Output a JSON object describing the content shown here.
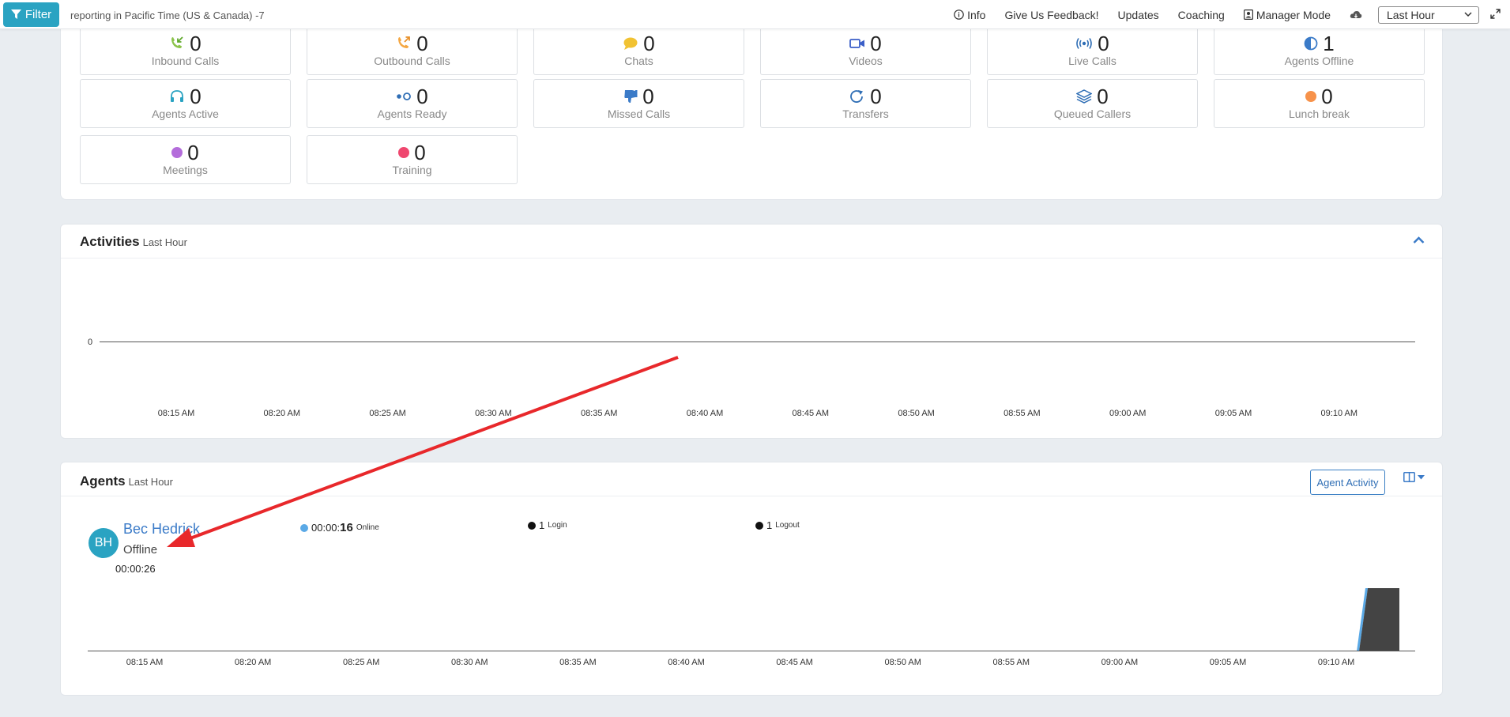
{
  "topbar": {
    "filter_label": "Filter",
    "timezone_text": "reporting in Pacific Time (US & Canada) -7",
    "links": {
      "info": "Info",
      "feedback": "Give Us Feedback!",
      "updates": "Updates",
      "coaching": "Coaching",
      "manager_mode": "Manager Mode"
    },
    "period_select": "Last Hour"
  },
  "stats": {
    "inbound_calls": {
      "value": "0",
      "label": "Inbound Calls"
    },
    "outbound_calls": {
      "value": "0",
      "label": "Outbound Calls"
    },
    "chats": {
      "value": "0",
      "label": "Chats"
    },
    "videos": {
      "value": "0",
      "label": "Videos"
    },
    "live_calls": {
      "value": "0",
      "label": "Live Calls"
    },
    "agents_offline": {
      "value": "1",
      "label": "Agents Offline"
    },
    "agents_active": {
      "value": "0",
      "label": "Agents Active"
    },
    "agents_ready": {
      "value": "0",
      "label": "Agents Ready"
    },
    "missed_calls": {
      "value": "0",
      "label": "Missed Calls"
    },
    "transfers": {
      "value": "0",
      "label": "Transfers"
    },
    "queued_callers": {
      "value": "0",
      "label": "Queued Callers"
    },
    "lunch_break": {
      "value": "0",
      "label": "Lunch break"
    },
    "meetings": {
      "value": "0",
      "label": "Meetings"
    },
    "training": {
      "value": "0",
      "label": "Training"
    }
  },
  "colors": {
    "accent": "#2aa3c2",
    "link": "#3b7bc8",
    "lunch_break": "#f7924a",
    "meetings": "#b46ddb",
    "training": "#ef476f",
    "chats": "#f1c232",
    "arrow": "#e8282b"
  },
  "activities": {
    "title": "Activities",
    "subtitle": "Last Hour",
    "y_label": "0",
    "ticks": [
      "08:15 AM",
      "08:20 AM",
      "08:25 AM",
      "08:30 AM",
      "08:35 AM",
      "08:40 AM",
      "08:45 AM",
      "08:50 AM",
      "08:55 AM",
      "09:00 AM",
      "09:05 AM",
      "09:10 AM"
    ]
  },
  "agents": {
    "title": "Agents",
    "subtitle": "Last Hour",
    "agent_activity_button": "Agent Activity",
    "agent": {
      "initials": "BH",
      "name": "Bec Hedrick",
      "status": "Offline",
      "duration": "00:00:26"
    },
    "legend": {
      "online_time_prefix": "00:00:",
      "online_time_bold": "16",
      "online_label": "Online",
      "login_count": "1",
      "login_label": "Login",
      "logout_count": "1",
      "logout_label": "Logout"
    },
    "ticks": [
      "08:15 AM",
      "08:20 AM",
      "08:25 AM",
      "08:30 AM",
      "08:35 AM",
      "08:40 AM",
      "08:45 AM",
      "08:50 AM",
      "08:55 AM",
      "09:00 AM",
      "09:05 AM",
      "09:10 AM"
    ]
  }
}
